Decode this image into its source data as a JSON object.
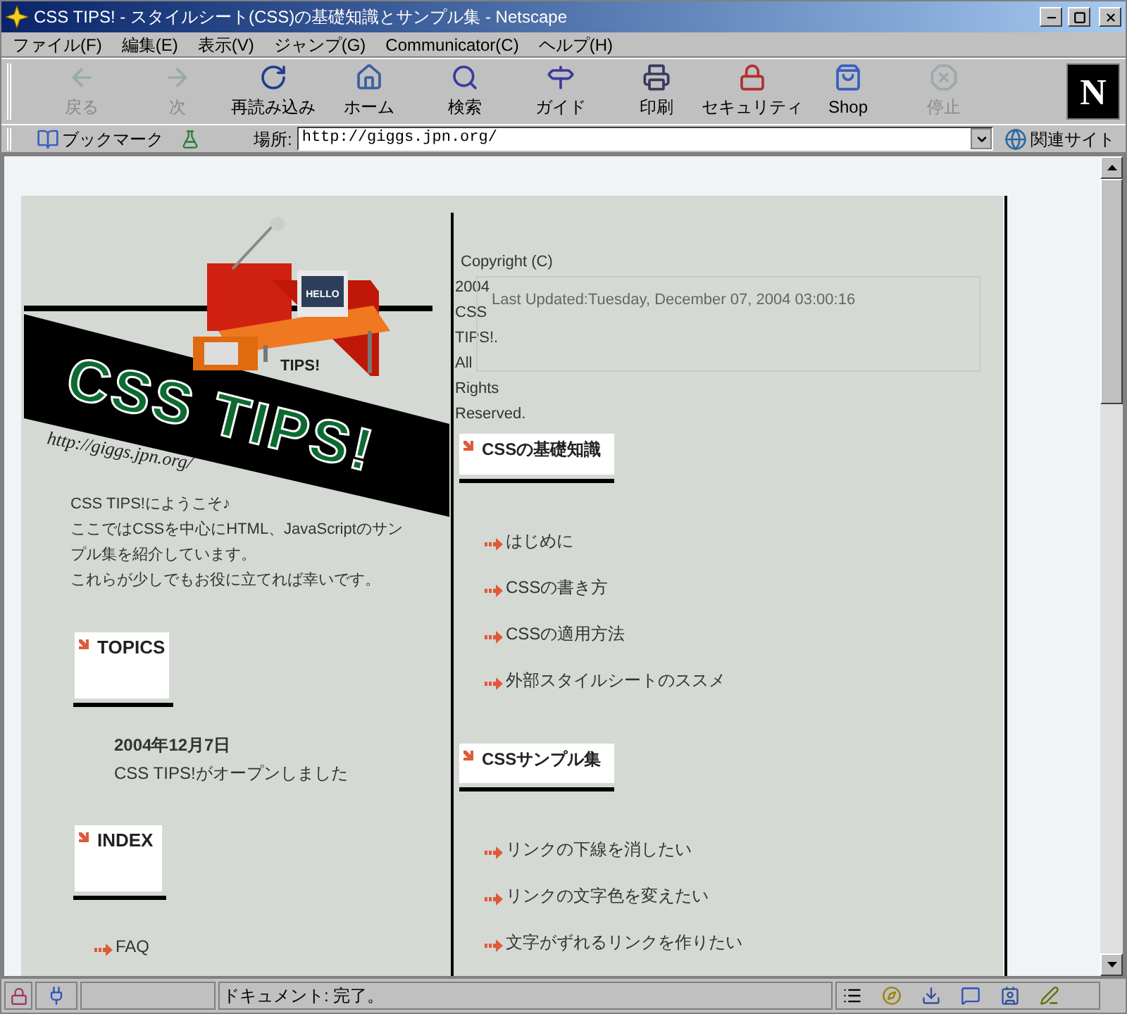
{
  "window": {
    "title": "CSS TIPS! - スタイルシート(CSS)の基礎知識とサンプル集 - Netscape"
  },
  "menu": [
    "ファイル(F)",
    "編集(E)",
    "表示(V)",
    "ジャンプ(G)",
    "Communicator(C)",
    "ヘルプ(H)"
  ],
  "toolbar": [
    {
      "label": "戻る",
      "disabled": true
    },
    {
      "label": "次",
      "disabled": true
    },
    {
      "label": "再読み込み",
      "disabled": false
    },
    {
      "label": "ホーム",
      "disabled": false
    },
    {
      "label": "検索",
      "disabled": false
    },
    {
      "label": "ガイド",
      "disabled": false
    },
    {
      "label": "印刷",
      "disabled": false
    },
    {
      "label": "セキュリティ",
      "disabled": false
    },
    {
      "label": "Shop",
      "disabled": false
    },
    {
      "label": "停止",
      "disabled": true
    }
  ],
  "brand_logo": {
    "letter": "N"
  },
  "location_bar": {
    "bookmarks_label": "ブックマーク",
    "location_label": "場所:",
    "url": "http://giggs.jpn.org/",
    "related_label": "関連サイト"
  },
  "page": {
    "logo": {
      "title": "CSS TIPS!",
      "url_text": "http://giggs.jpn.org/",
      "alt_fragment": "TIPS!",
      "monitor_text": "HELLO"
    },
    "welcome": [
      "CSS TIPS!にようこそ♪",
      "ここではCSSを中心にHTML、JavaScriptのサンプル集を紹介しています。",
      "これらが少しでもお役に立てれば幸いです。"
    ],
    "left_sections": [
      {
        "heading": "TOPICS",
        "items": [
          {
            "kind": "news",
            "date": "2004年12月7日",
            "text": "CSS TIPS!がオープンしました"
          }
        ]
      },
      {
        "heading": "INDEX",
        "items": [
          {
            "kind": "link",
            "text": "FAQ"
          }
        ]
      }
    ],
    "copyright_lines": [
      "Copyright (C)",
      "2004",
      "CSS",
      "TIPS!.",
      "All",
      "Rights",
      "Reserved."
    ],
    "last_updated": "Last Updated:Tuesday, December 07, 2004 03:00:16",
    "right_sections": [
      {
        "heading": "CSSの基礎知識",
        "items": [
          {
            "kind": "link",
            "text": "はじめに"
          },
          {
            "kind": "link",
            "text": "CSSの書き方"
          },
          {
            "kind": "link",
            "text": "CSSの適用方法"
          },
          {
            "kind": "link",
            "text": "外部スタイルシートのススメ"
          }
        ]
      },
      {
        "heading": "CSSサンプル集",
        "items": [
          {
            "kind": "link",
            "text": "リンクの下線を消したい"
          },
          {
            "kind": "link",
            "text": "リンクの文字色を変えたい"
          },
          {
            "kind": "link",
            "text": "文字がずれるリンクを作りたい"
          }
        ]
      }
    ]
  },
  "status_bar": {
    "text": "ドキュメント: 完了。"
  }
}
